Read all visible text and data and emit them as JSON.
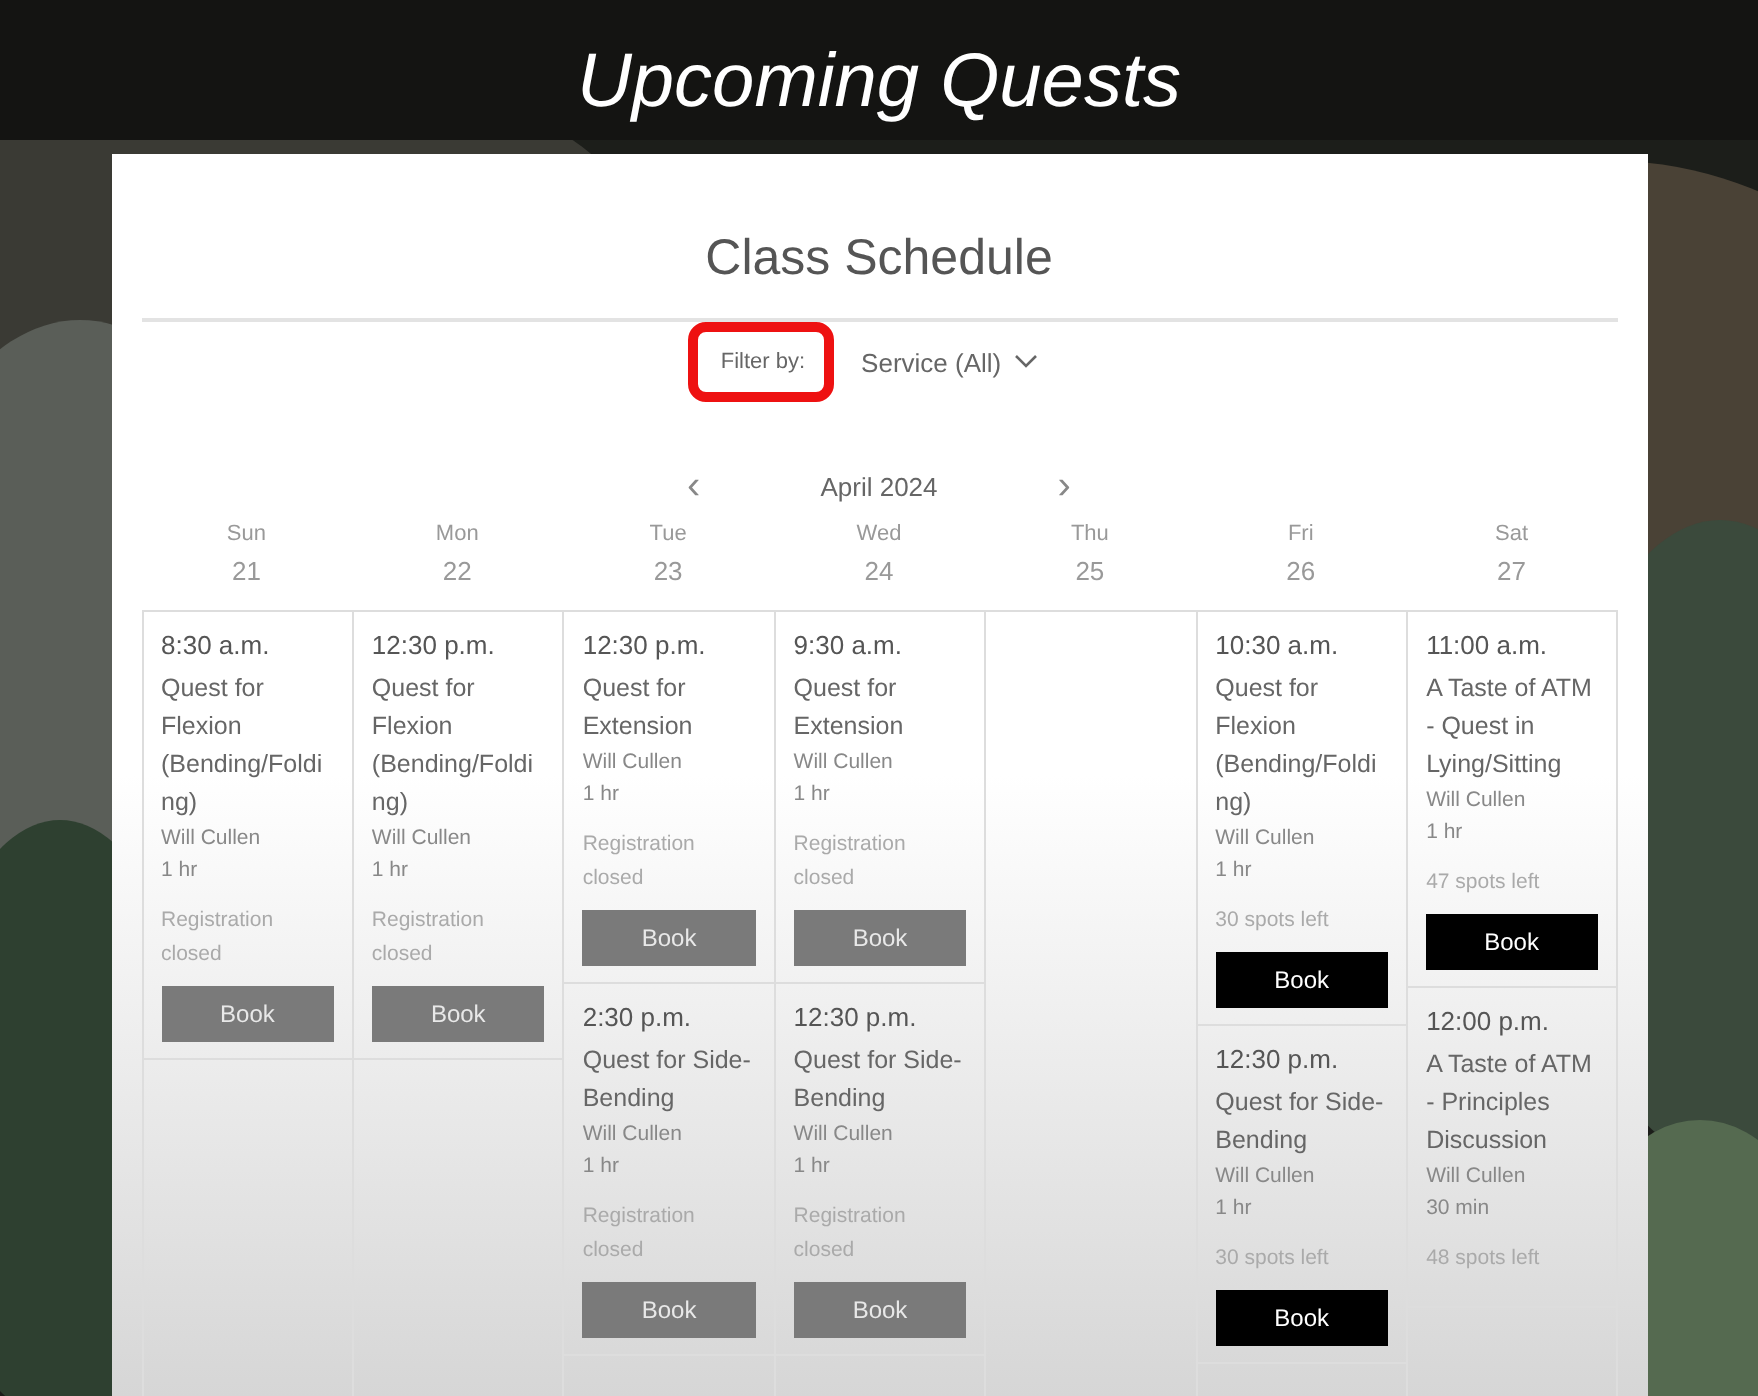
{
  "page_title": "Upcoming Quests",
  "schedule": {
    "title": "Class Schedule",
    "filter_label": "Filter by:",
    "filter_highlighted": true,
    "filter_value": "Service (All)",
    "prev": "‹",
    "month": "April 2024",
    "next": "›",
    "days": [
      {
        "day": "Sun",
        "date": "21",
        "classes": [
          {
            "time": "8:30 a.m.",
            "name": "Quest for Flexion (Bending/Folding)",
            "instructor": "Will Cullen",
            "duration": "1 hr",
            "availability": "Registration closed",
            "book_disabled": true,
            "button": "Book"
          }
        ]
      },
      {
        "day": "Mon",
        "date": "22",
        "classes": [
          {
            "time": "12:30 p.m.",
            "name": "Quest for Flexion (Bending/Folding)",
            "instructor": "Will Cullen",
            "duration": "1 hr",
            "availability": "Registration closed",
            "book_disabled": true,
            "button": "Book"
          }
        ]
      },
      {
        "day": "Tue",
        "date": "23",
        "classes": [
          {
            "time": "12:30 p.m.",
            "name": "Quest for Extension",
            "instructor": "Will Cullen",
            "duration": "1 hr",
            "availability": "Registration closed",
            "book_disabled": true,
            "button": "Book"
          },
          {
            "time": "2:30 p.m.",
            "name": "Quest for Side-Bending",
            "instructor": "Will Cullen",
            "duration": "1 hr",
            "availability": "Registration closed",
            "book_disabled": true,
            "button": "Book"
          }
        ]
      },
      {
        "day": "Wed",
        "date": "24",
        "classes": [
          {
            "time": "9:30 a.m.",
            "name": "Quest for Extension",
            "instructor": "Will Cullen",
            "duration": "1 hr",
            "availability": "Registration closed",
            "book_disabled": true,
            "button": "Book"
          },
          {
            "time": "12:30 p.m.",
            "name": "Quest for Side-Bending",
            "instructor": "Will Cullen",
            "duration": "1 hr",
            "availability": "Registration closed",
            "book_disabled": true,
            "button": "Book"
          }
        ]
      },
      {
        "day": "Thu",
        "date": "25"
      },
      {
        "day": "Fri",
        "date": "26",
        "classes": [
          {
            "time": "10:30 a.m.",
            "name": "Quest for Flexion (Bending/Folding)",
            "instructor": "Will Cullen",
            "duration": "1 hr",
            "availability": "30 spots left",
            "book_disabled": false,
            "button": "Book"
          },
          {
            "time": "12:30 p.m.",
            "name": "Quest for Side-Bending",
            "instructor": "Will Cullen",
            "duration": "1 hr",
            "availability": "30 spots left",
            "book_disabled": false,
            "button": "Book"
          }
        ]
      },
      {
        "day": "Sat",
        "date": "27",
        "classes": [
          {
            "time": "11:00 a.m.",
            "name": "A Taste of ATM - Quest in Lying/Sitting",
            "instructor": "Will Cullen",
            "duration": "1 hr",
            "availability": "47 spots left",
            "book_disabled": false,
            "button": "Book"
          },
          {
            "time": "12:00 p.m.",
            "name": "A Taste of ATM - Principles Discussion",
            "instructor": "Will Cullen",
            "duration": "30 min",
            "availability": "48 spots left"
          }
        ]
      }
    ]
  }
}
